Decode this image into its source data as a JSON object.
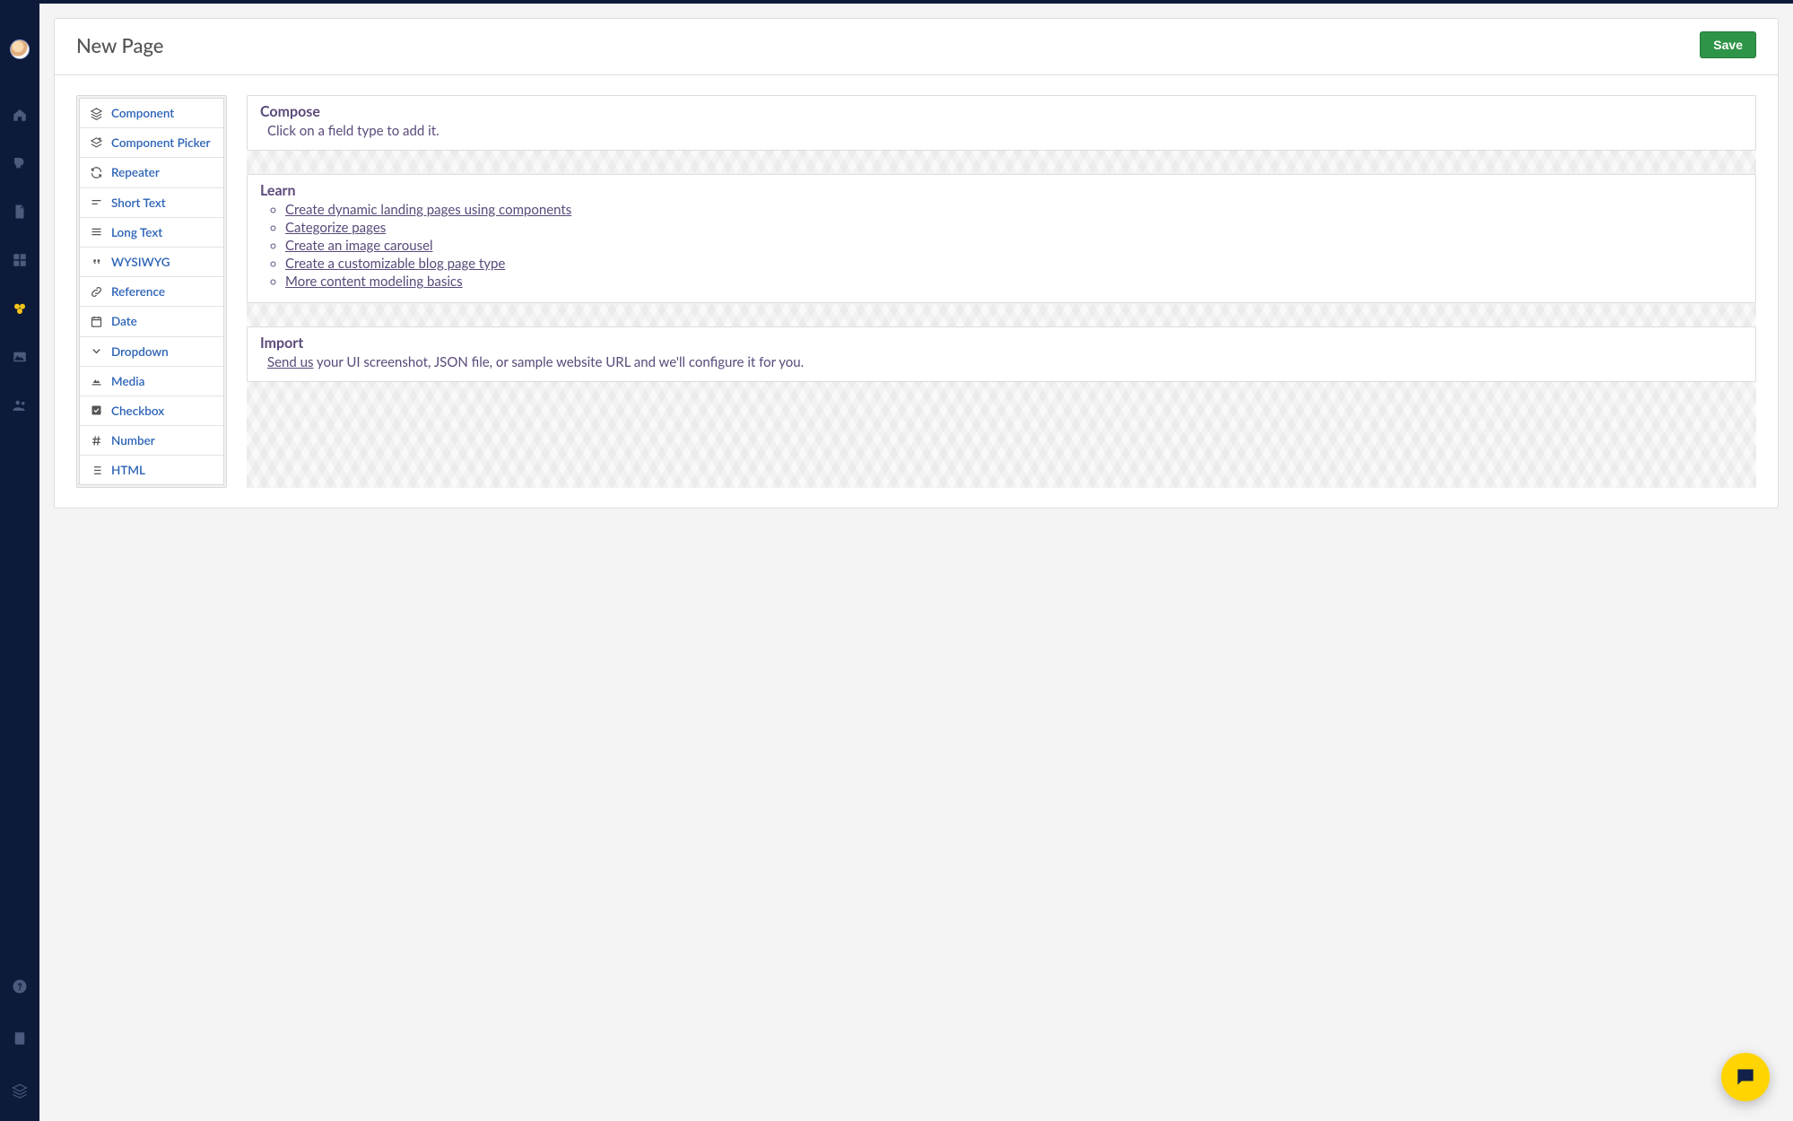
{
  "header": {
    "title": "New Page",
    "save_label": "Save"
  },
  "palette": {
    "items": [
      {
        "icon": "layers-icon",
        "label": "Component"
      },
      {
        "icon": "layers-plus-icon",
        "label": "Component Picker"
      },
      {
        "icon": "repeat-icon",
        "label": "Repeater"
      },
      {
        "icon": "short-text-icon",
        "label": "Short Text"
      },
      {
        "icon": "long-text-icon",
        "label": "Long Text"
      },
      {
        "icon": "quote-icon",
        "label": "WYSIWYG"
      },
      {
        "icon": "link-icon",
        "label": "Reference"
      },
      {
        "icon": "calendar-icon",
        "label": "Date"
      },
      {
        "icon": "chevron-down-icon",
        "label": "Dropdown"
      },
      {
        "icon": "chart-icon",
        "label": "Media"
      },
      {
        "icon": "checkbox-icon",
        "label": "Checkbox"
      },
      {
        "icon": "hash-icon",
        "label": "Number"
      },
      {
        "icon": "list-icon",
        "label": "HTML"
      }
    ]
  },
  "compose": {
    "heading": "Compose",
    "subtext": "Click on a field type to add it."
  },
  "learn": {
    "heading": "Learn",
    "links": [
      "Create dynamic landing pages using components",
      "Categorize pages",
      "Create an image carousel",
      "Create a customizable blog page type",
      "More content modeling basics"
    ]
  },
  "import": {
    "heading": "Import",
    "link_text": "Send us",
    "rest_text": " your UI screenshot, JSON file, or sample website URL and we'll configure it for you."
  },
  "sidebar": {
    "items": [
      {
        "name": "home-icon"
      },
      {
        "name": "blog-icon"
      },
      {
        "name": "page-icon"
      },
      {
        "name": "grid-icon"
      },
      {
        "name": "components-icon",
        "active": true
      },
      {
        "name": "media-icon"
      },
      {
        "name": "users-icon"
      }
    ],
    "bottom": [
      {
        "name": "help-icon"
      },
      {
        "name": "book-icon"
      },
      {
        "name": "stack-icon"
      }
    ]
  }
}
